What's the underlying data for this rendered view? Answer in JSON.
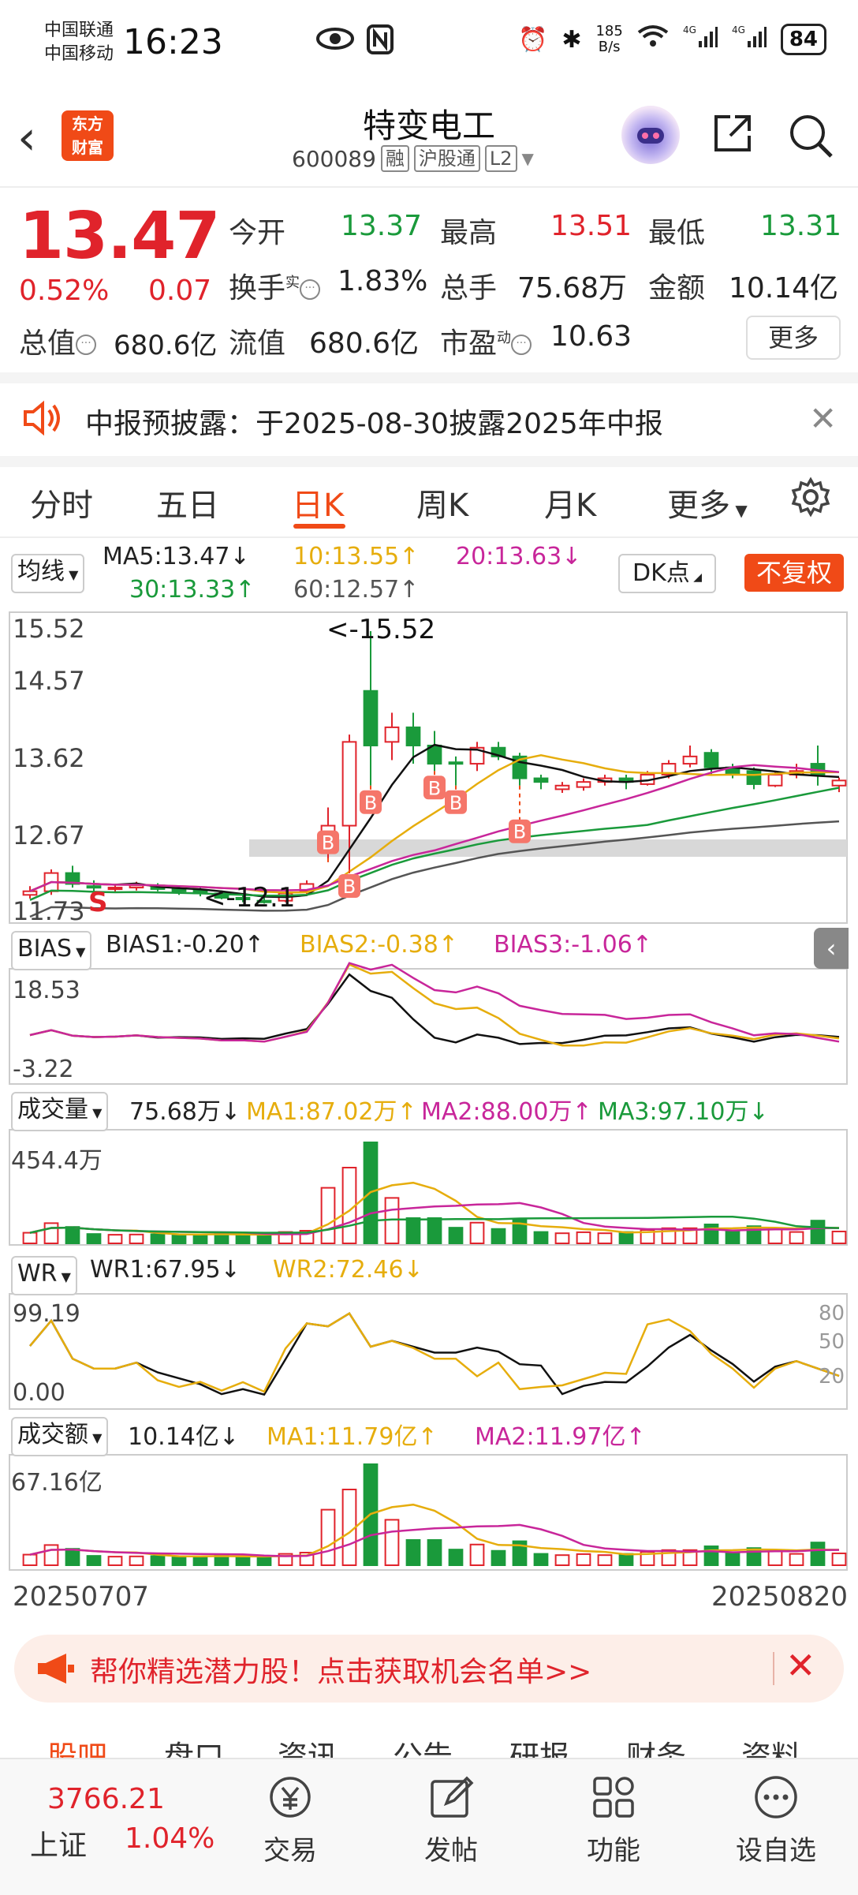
{
  "status_bar": {
    "carrier1": "中国联通",
    "carrier2": "中国移动",
    "time": "16:23",
    "net_speed": "185\nB/s",
    "battery": "84"
  },
  "header": {
    "back": "‹",
    "logo_line1": "东方",
    "logo_line2": "财富",
    "title": "特变电工",
    "code": "600089",
    "tag1": "融",
    "tag2": "沪股通",
    "tag3": "L2"
  },
  "quote": {
    "price": "13.47",
    "pct": "0.52%",
    "change": "0.07",
    "open_label": "今开",
    "open": "13.37",
    "high_label": "最高",
    "high": "13.51",
    "low_label": "最低",
    "low": "13.31",
    "turnover_label": "换手",
    "turnover_sup": "实",
    "turnover": "1.83%",
    "volume_label": "总手",
    "volume": "75.68万",
    "amount_label": "金额",
    "amount": "10.14亿",
    "mktcap_label": "总值",
    "mktcap": "680.6亿",
    "float_label": "流值",
    "float": "680.6亿",
    "pe_label": "市盈",
    "pe_sup": "动",
    "pe": "10.63",
    "more": "更多"
  },
  "notice": {
    "text": "中报预披露：于2025-08-30披露2025年中报",
    "close": "✕"
  },
  "tabs": [
    "分时",
    "五日",
    "日K",
    "周K",
    "月K",
    "更多"
  ],
  "indicator_bar": {
    "select": "均线",
    "ma5": "MA5:13.47↓",
    "ma10": "10:13.55↑",
    "ma20": "20:13.63↓",
    "ma30": "30:13.33↑",
    "ma60": "60:12.57↑",
    "dk": "DK点",
    "fuquan": "不复权"
  },
  "kline_labels": {
    "y_top": "15.52",
    "y2": "14.57",
    "y3": "13.62",
    "y4": "12.67",
    "y_bottom": "11.73",
    "high_mark": "<-15.52",
    "low_mark": "<-12.1",
    "buy": "B",
    "sell": "S"
  },
  "bias": {
    "select": "BIAS",
    "b1": "BIAS1:-0.20↑",
    "b2": "BIAS2:-0.38↑",
    "b3": "BIAS3:-1.06↑",
    "y_top": "18.53",
    "y_bottom": "-3.22"
  },
  "volume": {
    "select": "成交量",
    "v": "75.68万↓",
    "ma1": "MA1:87.02万↑",
    "ma2": "MA2:88.00万↑",
    "ma3": "MA3:97.10万↓",
    "y_top": "454.4万"
  },
  "wr": {
    "select": "WR",
    "wr1": "WR1:67.95↓",
    "wr2": "WR2:72.46↓",
    "y_top": "99.19",
    "y_bottom": "0.00",
    "r80": "80",
    "r50": "50",
    "r20": "20"
  },
  "amount": {
    "select": "成交额",
    "v": "10.14亿↓",
    "ma1": "MA1:11.79亿↑",
    "ma2": "MA2:11.97亿↑",
    "y_top": "67.16亿"
  },
  "dates": {
    "start": "20250707",
    "end": "20250820"
  },
  "promo": {
    "text": "帮你精选潜力股！点击获取机会名单>>",
    "close": "✕"
  },
  "subtabs": [
    "股吧",
    "盘口",
    "资讯",
    "公告",
    "研报",
    "财务",
    "资料"
  ],
  "bottom_bar": {
    "index_value": "3766.21",
    "index_name": "上证",
    "index_pct": "1.04%",
    "items": [
      "交易",
      "发帖",
      "功能",
      "设自选"
    ]
  },
  "colors": {
    "up": "#e0232b",
    "down": "#1a9a3b",
    "accent": "#f04a17",
    "ma5": "#111111",
    "ma10": "#e6ad0d",
    "ma20": "#c8269a",
    "ma30": "#1a9a3b",
    "ma60": "#555555"
  },
  "chart_data": {
    "type": "candlestick",
    "x_range": [
      "20250707",
      "20250820"
    ],
    "y_range": [
      11.73,
      15.52
    ],
    "candles": [
      {
        "o": 11.9,
        "h": 12.02,
        "l": 11.85,
        "c": 11.95
      },
      {
        "o": 11.95,
        "h": 12.25,
        "l": 11.9,
        "c": 12.2
      },
      {
        "o": 12.2,
        "h": 12.3,
        "l": 12.0,
        "c": 12.05
      },
      {
        "o": 12.02,
        "h": 12.1,
        "l": 11.95,
        "c": 12.0
      },
      {
        "o": 11.98,
        "h": 12.05,
        "l": 11.93,
        "c": 12.0
      },
      {
        "o": 12.0,
        "h": 12.08,
        "l": 11.96,
        "c": 12.03
      },
      {
        "o": 12.03,
        "h": 12.06,
        "l": 11.95,
        "c": 11.98
      },
      {
        "o": 11.98,
        "h": 12.03,
        "l": 11.9,
        "c": 11.95
      },
      {
        "o": 11.96,
        "h": 12.0,
        "l": 11.88,
        "c": 11.92
      },
      {
        "o": 11.92,
        "h": 11.96,
        "l": 11.84,
        "c": 11.86
      },
      {
        "o": 11.86,
        "h": 11.9,
        "l": 11.8,
        "c": 11.85
      },
      {
        "o": 11.82,
        "h": 11.88,
        "l": 11.78,
        "c": 11.8
      },
      {
        "o": 11.82,
        "h": 11.95,
        "l": 11.8,
        "c": 11.92
      },
      {
        "o": 11.95,
        "h": 12.1,
        "l": 11.9,
        "c": 12.05
      },
      {
        "o": 12.7,
        "h": 13.1,
        "l": 12.35,
        "c": 12.85
      },
      {
        "o": 12.85,
        "h": 14.1,
        "l": 12.25,
        "c": 14.0
      },
      {
        "o": 14.7,
        "h": 15.52,
        "l": 13.4,
        "c": 13.95
      },
      {
        "o": 14.0,
        "h": 14.4,
        "l": 13.75,
        "c": 14.2
      },
      {
        "o": 14.2,
        "h": 14.4,
        "l": 13.7,
        "c": 13.95
      },
      {
        "o": 13.95,
        "h": 14.15,
        "l": 13.6,
        "c": 13.7
      },
      {
        "o": 13.72,
        "h": 13.8,
        "l": 13.4,
        "c": 13.7
      },
      {
        "o": 13.7,
        "h": 14.0,
        "l": 13.6,
        "c": 13.92
      },
      {
        "o": 13.92,
        "h": 14.0,
        "l": 13.75,
        "c": 13.8
      },
      {
        "o": 13.8,
        "h": 13.85,
        "l": 13.4,
        "c": 13.5
      },
      {
        "o": 13.5,
        "h": 13.55,
        "l": 13.35,
        "c": 13.45
      },
      {
        "o": 13.35,
        "h": 13.45,
        "l": 13.3,
        "c": 13.4
      },
      {
        "o": 13.38,
        "h": 13.5,
        "l": 13.33,
        "c": 13.45
      },
      {
        "o": 13.45,
        "h": 13.55,
        "l": 13.4,
        "c": 13.5
      },
      {
        "o": 13.5,
        "h": 13.55,
        "l": 13.35,
        "c": 13.45
      },
      {
        "o": 13.42,
        "h": 13.6,
        "l": 13.4,
        "c": 13.55
      },
      {
        "o": 13.55,
        "h": 13.75,
        "l": 13.5,
        "c": 13.7
      },
      {
        "o": 13.7,
        "h": 13.95,
        "l": 13.65,
        "c": 13.8
      },
      {
        "o": 13.85,
        "h": 13.9,
        "l": 13.55,
        "c": 13.65
      },
      {
        "o": 13.65,
        "h": 13.7,
        "l": 13.5,
        "c": 13.55
      },
      {
        "o": 13.6,
        "h": 13.65,
        "l": 13.35,
        "c": 13.42
      },
      {
        "o": 13.4,
        "h": 13.6,
        "l": 13.38,
        "c": 13.55
      },
      {
        "o": 13.55,
        "h": 13.7,
        "l": 13.5,
        "c": 13.6
      },
      {
        "o": 13.7,
        "h": 13.95,
        "l": 13.4,
        "c": 13.55
      },
      {
        "o": 13.4,
        "h": 13.51,
        "l": 13.31,
        "c": 13.47
      }
    ],
    "volume_max": "454.4万",
    "wr_range": [
      0.0,
      99.19
    ],
    "bias_range": [
      -3.22,
      18.53
    ],
    "amount_max": "67.16亿"
  }
}
